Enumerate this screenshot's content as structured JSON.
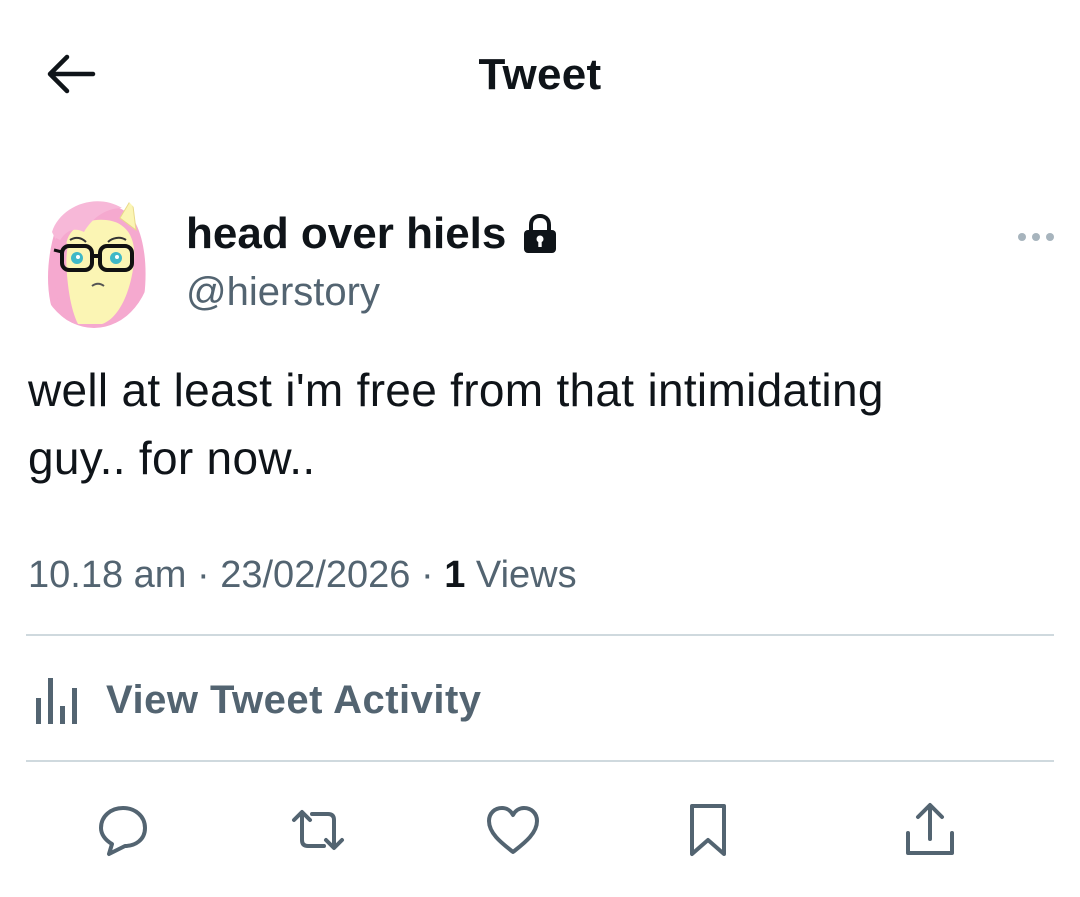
{
  "header": {
    "title": "Tweet",
    "back_icon": "arrow-left-icon"
  },
  "author": {
    "display_name": "head over hiels",
    "handle": "@hierstory",
    "protected_icon": "lock-icon",
    "avatar": "pink-haired pony with glasses cartoon avatar"
  },
  "tweet": {
    "text_line1": "well at least i'm free from that intimidating",
    "text_line2": "guy.. for now..",
    "time": "10.18 am",
    "separator": "·",
    "date": "23/02/2026",
    "views_count": "1",
    "views_label": "Views"
  },
  "activity": {
    "label": "View Tweet Activity",
    "icon": "bar-chart-icon"
  },
  "actions": [
    {
      "name": "reply",
      "icon": "reply-icon"
    },
    {
      "name": "retweet",
      "icon": "retweet-icon"
    },
    {
      "name": "like",
      "icon": "heart-icon"
    },
    {
      "name": "bookmark",
      "icon": "bookmark-icon"
    },
    {
      "name": "share",
      "icon": "share-icon"
    }
  ],
  "colors": {
    "text_primary": "#0f1419",
    "text_secondary": "#536471",
    "divider": "#cfd9de",
    "avatar_hair": "#f5a9cf",
    "avatar_skin": "#fbf5b4",
    "avatar_eyes": "#3fb8c7"
  }
}
